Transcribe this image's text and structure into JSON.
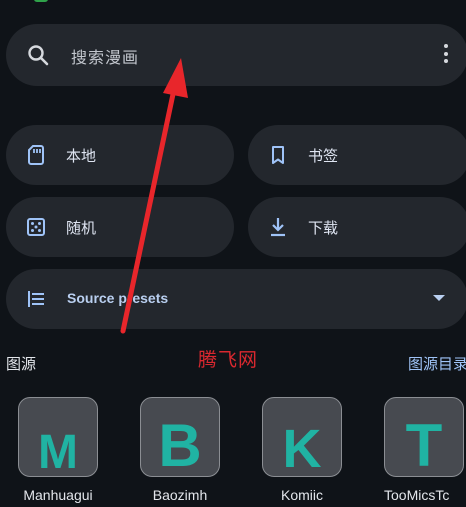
{
  "search": {
    "placeholder": "搜索漫画"
  },
  "quick_actions": [
    {
      "label": "本地",
      "icon": "sd-card-icon"
    },
    {
      "label": "书签",
      "icon": "bookmark-icon"
    },
    {
      "label": "随机",
      "icon": "dice-icon"
    },
    {
      "label": "下载",
      "icon": "download-icon"
    }
  ],
  "presets": {
    "label": "Source presets",
    "icon": "list-icon"
  },
  "sources_section": {
    "title": "图源",
    "link": "图源目录"
  },
  "watermark": "腾飞网",
  "sources": [
    {
      "letter": "M",
      "name": "Manhuagui"
    },
    {
      "letter": "B",
      "name": "Baozimh"
    },
    {
      "letter": "K",
      "name": "Komiic"
    },
    {
      "letter": "T",
      "name": "TooMicsTc"
    }
  ],
  "colors": {
    "background": "#0f1318",
    "surface": "#23272d",
    "accent_text": "#9fc3f7",
    "tile_letter": "#20b3a3",
    "annotation": "#e8262b"
  }
}
